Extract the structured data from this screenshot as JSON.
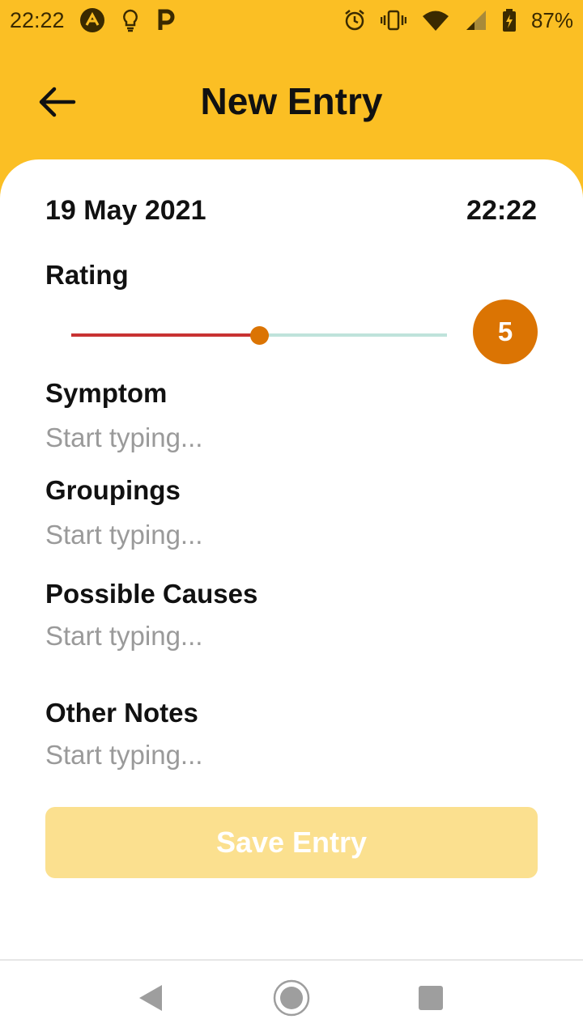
{
  "status_bar": {
    "time": "22:22",
    "battery": "87%",
    "icons": [
      "arc-app-icon",
      "lightbulb-icon",
      "parking-icon",
      "alarm-icon",
      "vibrate-icon",
      "wifi-icon",
      "signal-icon",
      "battery-charging-icon"
    ]
  },
  "header": {
    "title": "New Entry",
    "back_icon": "arrow-left-icon"
  },
  "entry": {
    "date": "19 May 2021",
    "time": "22:22"
  },
  "rating": {
    "label": "Rating",
    "value": "5",
    "fraction": 0.5
  },
  "fields": {
    "symptom": {
      "label": "Symptom",
      "placeholder": "Start typing..."
    },
    "groupings": {
      "label": "Groupings",
      "placeholder": "Start typing..."
    },
    "possible_causes": {
      "label": "Possible Causes",
      "placeholder": "Start typing..."
    },
    "other_notes": {
      "label": "Other Notes",
      "placeholder": "Start typing..."
    }
  },
  "save_button": {
    "label": "Save Entry"
  },
  "colors": {
    "header_bg": "#FBBF24",
    "accent": "#DB7403",
    "slider_fill": "#C83232",
    "slider_track": "#BFE3DB",
    "save_disabled": "#FBE08F"
  },
  "nav": {
    "icons": [
      "back-triangle-icon",
      "home-circle-icon",
      "recents-square-icon"
    ]
  }
}
